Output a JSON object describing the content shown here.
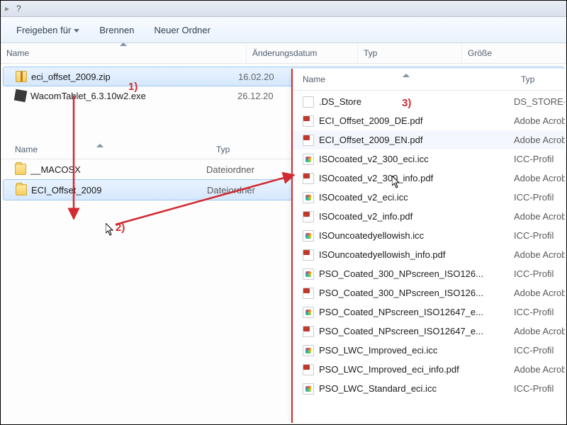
{
  "title_fragment": "?",
  "toolbar": {
    "share_label": "Freigeben für",
    "burn_label": "Brennen",
    "newfolder_label": "Neuer Ordner"
  },
  "columns": {
    "name": "Name",
    "date": "Änderungsdatum",
    "type": "Typ",
    "size": "Größe"
  },
  "upper_rows": [
    {
      "name": "eci_offset_2009.zip",
      "date": "16.02.20",
      "icon": "zip",
      "selected": true
    },
    {
      "name": "WacomTablet_6.3.10w2.exe",
      "date": "26.12.20",
      "icon": "exe",
      "selected": false
    }
  ],
  "sub_columns": {
    "name": "Name",
    "type": "Typ"
  },
  "sub_type_label": "Dateiordner",
  "sub_rows": [
    {
      "name": "__MACOSX",
      "selected": false
    },
    {
      "name": "ECI_Offset_2009",
      "selected": true
    }
  ],
  "right_columns": {
    "name": "Name",
    "type": "Typ"
  },
  "right_rows": [
    {
      "name": ".DS_Store",
      "type": "DS_STORE-Da",
      "icon": "file"
    },
    {
      "name": "ECI_Offset_2009_DE.pdf",
      "type": "Adobe Acrob",
      "icon": "pdf"
    },
    {
      "name": "ECI_Offset_2009_EN.pdf",
      "type": "Adobe Acrob",
      "icon": "pdf",
      "highlight": true
    },
    {
      "name": "ISOcoated_v2_300_eci.icc",
      "type": "ICC-Profil",
      "icon": "icc"
    },
    {
      "name": "ISOcoated_v2_300_info.pdf",
      "type": "Adobe Acrob",
      "icon": "pdf"
    },
    {
      "name": "ISOcoated_v2_eci.icc",
      "type": "ICC-Profil",
      "icon": "icc"
    },
    {
      "name": "ISOcoated_v2_info.pdf",
      "type": "Adobe Acrob",
      "icon": "pdf"
    },
    {
      "name": "ISOuncoatedyellowish.icc",
      "type": "ICC-Profil",
      "icon": "icc"
    },
    {
      "name": "ISOuncoatedyellowish_info.pdf",
      "type": "Adobe Acrob",
      "icon": "pdf"
    },
    {
      "name": "PSO_Coated_300_NPscreen_ISO126...",
      "type": "ICC-Profil",
      "icon": "icc"
    },
    {
      "name": "PSO_Coated_300_NPscreen_ISO126...",
      "type": "Adobe Acrob",
      "icon": "pdf"
    },
    {
      "name": "PSO_Coated_NPscreen_ISO12647_e...",
      "type": "ICC-Profil",
      "icon": "icc"
    },
    {
      "name": "PSO_Coated_NPscreen_ISO12647_e...",
      "type": "Adobe Acrob",
      "icon": "pdf"
    },
    {
      "name": "PSO_LWC_Improved_eci.icc",
      "type": "ICC-Profil",
      "icon": "icc"
    },
    {
      "name": "PSO_LWC_Improved_eci_info.pdf",
      "type": "Adobe Acrob",
      "icon": "pdf"
    },
    {
      "name": "PSO_LWC_Standard_eci.icc",
      "type": "ICC-Profil",
      "icon": "icc"
    }
  ],
  "annotations": {
    "step1": "1)",
    "step2": "2)",
    "step3": "3)"
  }
}
